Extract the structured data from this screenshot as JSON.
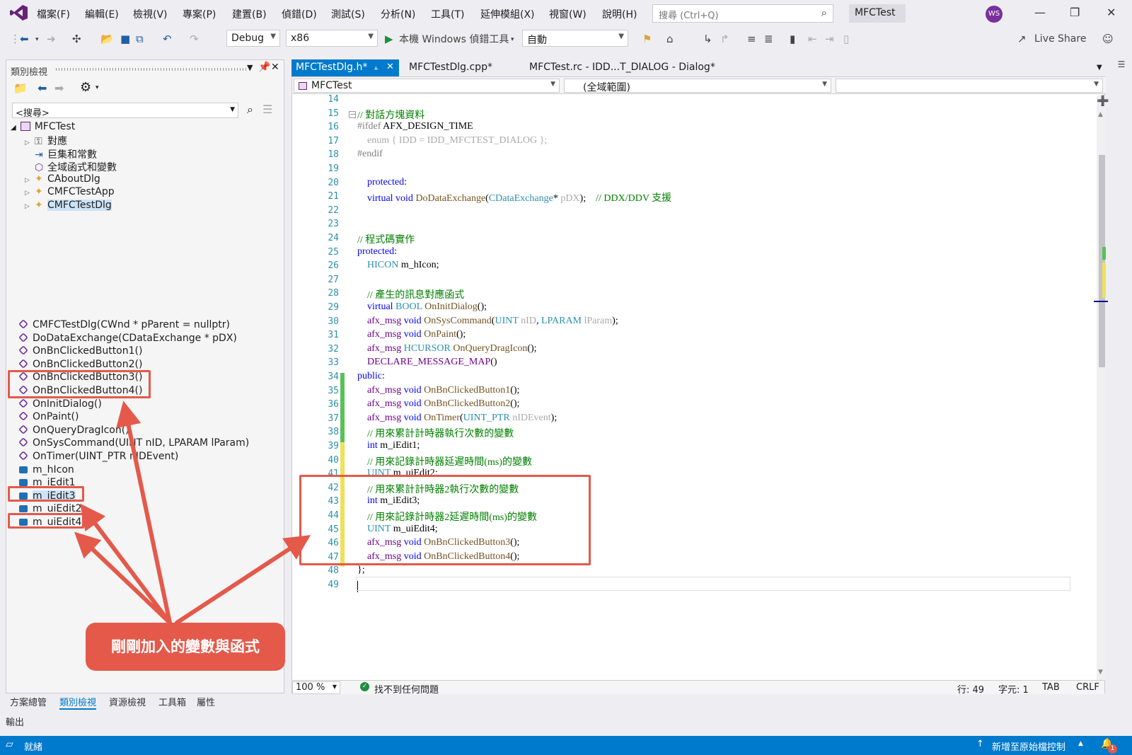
{
  "menu": {
    "items": [
      "檔案(F)",
      "編輯(E)",
      "檢視(V)",
      "專案(P)",
      "建置(B)",
      "偵錯(D)",
      "測試(S)",
      "分析(N)",
      "工具(T)",
      "延伸模組(X)",
      "視窗(W)",
      "說明(H)"
    ],
    "search_placeholder": "搜尋 (Ctrl+Q)",
    "project_name": "MFCTest",
    "avatar_initials": "WS"
  },
  "toolbar": {
    "config": "Debug",
    "platform": "x86",
    "debugger": "本機 Windows 偵錯工具",
    "target": "自動",
    "live_share": "Live Share"
  },
  "class_view": {
    "title": "類別檢視",
    "search_placeholder": "<搜尋>",
    "root": "MFCTest",
    "tree": [
      {
        "label": "對應",
        "icon": "key-icon"
      },
      {
        "label": "巨集和常數",
        "icon": "macro-icon"
      },
      {
        "label": "全域函式和變數",
        "icon": "global-icon"
      },
      {
        "label": "CAboutDlg",
        "icon": "class-icon"
      },
      {
        "label": "CMFCTestApp",
        "icon": "class-icon"
      },
      {
        "label": "CMFCTestDlg",
        "icon": "class-icon"
      }
    ],
    "members": [
      {
        "label": "CMFCTestDlg(CWnd * pParent = nullptr)",
        "kind": "method"
      },
      {
        "label": "DoDataExchange(CDataExchange * pDX)",
        "kind": "method"
      },
      {
        "label": "OnBnClickedButton1()",
        "kind": "method"
      },
      {
        "label": "OnBnClickedButton2()",
        "kind": "method"
      },
      {
        "label": "OnBnClickedButton3()",
        "kind": "method"
      },
      {
        "label": "OnBnClickedButton4()",
        "kind": "method"
      },
      {
        "label": "OnInitDialog()",
        "kind": "method"
      },
      {
        "label": "OnPaint()",
        "kind": "method"
      },
      {
        "label": "OnQueryDragIcon()",
        "kind": "method"
      },
      {
        "label": "OnSysCommand(UINT nID, LPARAM lParam)",
        "kind": "method"
      },
      {
        "label": "OnTimer(UINT_PTR nIDEvent)",
        "kind": "method"
      },
      {
        "label": "m_hIcon",
        "kind": "field"
      },
      {
        "label": "m_iEdit1",
        "kind": "field"
      },
      {
        "label": "m_iEdit3",
        "kind": "field"
      },
      {
        "label": "m_uiEdit2",
        "kind": "field"
      },
      {
        "label": "m_uiEdit4",
        "kind": "field"
      }
    ],
    "bottom_tabs": [
      "方案總管",
      "類別檢視",
      "資源檢視",
      "工具箱",
      "屬性"
    ],
    "output_label": "輸出"
  },
  "doc_tabs": [
    "MFCTestDlg.h*",
    "MFCTestDlg.cpp*",
    "MFCTest.rc - IDD...T_DIALOG - Dialog*"
  ],
  "nav": {
    "project": "MFCTest",
    "scope": "(全域範圍)"
  },
  "code_lines": [
    {
      "n": "14",
      "parts": []
    },
    {
      "n": "15",
      "parts": [
        [
          "cm",
          "// 對話方塊資料"
        ]
      ]
    },
    {
      "n": "16",
      "parts": [
        [
          "pp",
          "#ifdef "
        ],
        [
          "",
          "AFX_DESIGN_TIME"
        ]
      ]
    },
    {
      "n": "17",
      "parts": [
        [
          "gray",
          "    enum { IDD = IDD_MFCTEST_DIALOG };"
        ]
      ]
    },
    {
      "n": "18",
      "parts": [
        [
          "pp",
          "#endif"
        ]
      ]
    },
    {
      "n": "19",
      "parts": []
    },
    {
      "n": "20",
      "parts": [
        [
          "kw",
          "    protected"
        ],
        [
          "",
          ":"
        ]
      ]
    },
    {
      "n": "21",
      "parts": [
        [
          "kw",
          "    virtual void "
        ],
        [
          "fn",
          "DoDataExchange"
        ],
        [
          "",
          "("
        ],
        [
          "ty",
          "CDataExchange"
        ],
        [
          "",
          "* "
        ],
        [
          "gray",
          "pDX"
        ],
        [
          "",
          ");    "
        ],
        [
          "cm",
          "// DDX/DDV 支援"
        ]
      ]
    },
    {
      "n": "22",
      "parts": []
    },
    {
      "n": "23",
      "parts": []
    },
    {
      "n": "24",
      "parts": [
        [
          "cm",
          "// 程式碼實作"
        ]
      ]
    },
    {
      "n": "25",
      "parts": [
        [
          "kw",
          "protected"
        ],
        [
          "",
          ":"
        ]
      ]
    },
    {
      "n": "26",
      "parts": [
        [
          "ty",
          "    HICON "
        ],
        [
          "",
          "m_hIcon;"
        ]
      ]
    },
    {
      "n": "27",
      "parts": []
    },
    {
      "n": "28",
      "parts": [
        [
          "cm",
          "    // 產生的訊息對應函式"
        ]
      ]
    },
    {
      "n": "29",
      "parts": [
        [
          "kw",
          "    virtual "
        ],
        [
          "ty",
          "BOOL "
        ],
        [
          "fn",
          "OnInitDialog"
        ],
        [
          "",
          "();"
        ]
      ]
    },
    {
      "n": "30",
      "parts": [
        [
          "mac",
          "    afx_msg "
        ],
        [
          "kw",
          "void "
        ],
        [
          "fn",
          "OnSysCommand"
        ],
        [
          "",
          "("
        ],
        [
          "ty",
          "UINT "
        ],
        [
          "gray",
          "nID"
        ],
        [
          "",
          ", "
        ],
        [
          "ty",
          "LPARAM "
        ],
        [
          "gray",
          "lParam"
        ],
        [
          "",
          ");"
        ]
      ]
    },
    {
      "n": "31",
      "parts": [
        [
          "mac",
          "    afx_msg "
        ],
        [
          "kw",
          "void "
        ],
        [
          "fn",
          "OnPaint"
        ],
        [
          "",
          "();"
        ]
      ]
    },
    {
      "n": "32",
      "parts": [
        [
          "mac",
          "    afx_msg "
        ],
        [
          "ty",
          "HCURSOR "
        ],
        [
          "fn",
          "OnQueryDragIcon"
        ],
        [
          "",
          "();"
        ]
      ]
    },
    {
      "n": "33",
      "parts": [
        [
          "mac",
          "    DECLARE_MESSAGE_MAP"
        ],
        [
          "",
          "()"
        ]
      ]
    },
    {
      "n": "34",
      "parts": [
        [
          "kw",
          "public"
        ],
        [
          "",
          ":"
        ]
      ]
    },
    {
      "n": "35",
      "parts": [
        [
          "mac",
          "    afx_msg "
        ],
        [
          "kw",
          "void "
        ],
        [
          "fn",
          "OnBnClickedButton1"
        ],
        [
          "",
          "();"
        ]
      ]
    },
    {
      "n": "36",
      "parts": [
        [
          "mac",
          "    afx_msg "
        ],
        [
          "kw",
          "void "
        ],
        [
          "fn",
          "OnBnClickedButton2"
        ],
        [
          "",
          "();"
        ]
      ]
    },
    {
      "n": "37",
      "parts": [
        [
          "mac",
          "    afx_msg "
        ],
        [
          "kw",
          "void "
        ],
        [
          "fn",
          "OnTimer"
        ],
        [
          "",
          "("
        ],
        [
          "ty",
          "UINT_PTR "
        ],
        [
          "gray",
          "nIDEvent"
        ],
        [
          "",
          ");"
        ]
      ]
    },
    {
      "n": "38",
      "parts": [
        [
          "cm",
          "    // 用來累計計時器執行次數的變數"
        ]
      ]
    },
    {
      "n": "39",
      "parts": [
        [
          "kw",
          "    int "
        ],
        [
          "",
          "m_iEdit1;"
        ]
      ]
    },
    {
      "n": "40",
      "parts": [
        [
          "cm",
          "    // 用來記錄計時器延遲時間(ms)的變數"
        ]
      ]
    },
    {
      "n": "41",
      "parts": [
        [
          "ty",
          "    UINT "
        ],
        [
          "",
          "m_uiEdit2;"
        ]
      ]
    },
    {
      "n": "42",
      "parts": [
        [
          "cm",
          "    // 用來累計計時器2執行次數的變數"
        ]
      ]
    },
    {
      "n": "43",
      "parts": [
        [
          "kw",
          "    int "
        ],
        [
          "",
          "m_iEdit3;"
        ]
      ]
    },
    {
      "n": "44",
      "parts": [
        [
          "cm",
          "    // 用來記錄計時器2延遲時間(ms)的變數"
        ]
      ]
    },
    {
      "n": "45",
      "parts": [
        [
          "ty",
          "    UINT "
        ],
        [
          "",
          "m_uiEdit4;"
        ]
      ]
    },
    {
      "n": "46",
      "parts": [
        [
          "mac",
          "    afx_msg "
        ],
        [
          "kw",
          "void "
        ],
        [
          "fn",
          "OnBnClickedButton3"
        ],
        [
          "",
          "();"
        ]
      ]
    },
    {
      "n": "47",
      "parts": [
        [
          "mac",
          "    afx_msg "
        ],
        [
          "kw",
          "void "
        ],
        [
          "fn",
          "OnBnClickedButton4"
        ],
        [
          "",
          "();"
        ]
      ]
    },
    {
      "n": "48",
      "parts": [
        [
          "",
          "};"
        ]
      ]
    },
    {
      "n": "49",
      "parts": []
    }
  ],
  "editor_status": {
    "zoom": "100 %",
    "issues": "找不到任何問題",
    "line": "行: 49",
    "col": "字元: 1",
    "tab": "TAB",
    "eol": "CRLF"
  },
  "statusbar": {
    "ready": "就緒",
    "source_control": "新增至原始檔控制",
    "notifications": "1"
  },
  "annotation": {
    "callout": "剛剛加入的變數與函式"
  },
  "colors": {
    "accent": "#007acc",
    "annotation": "#e4594a",
    "tab_active": "#007acc"
  }
}
